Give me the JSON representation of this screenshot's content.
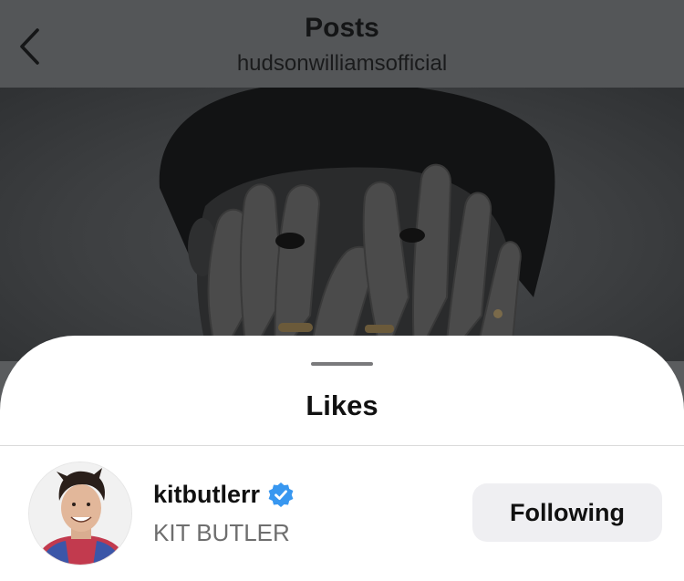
{
  "header": {
    "title": "Posts",
    "subtitle": "hudsonwilliamsofficial",
    "back_icon": "chevron-left-icon"
  },
  "sheet": {
    "title": "Likes"
  },
  "likes": [
    {
      "username": "kitbutlerr",
      "verified": true,
      "full_name": "KIT BUTLER",
      "button_label": "Following"
    }
  ],
  "colors": {
    "verified_badge": "#3897f0",
    "button_bg": "#efeff2",
    "secondary_text": "#6e6e6e"
  }
}
